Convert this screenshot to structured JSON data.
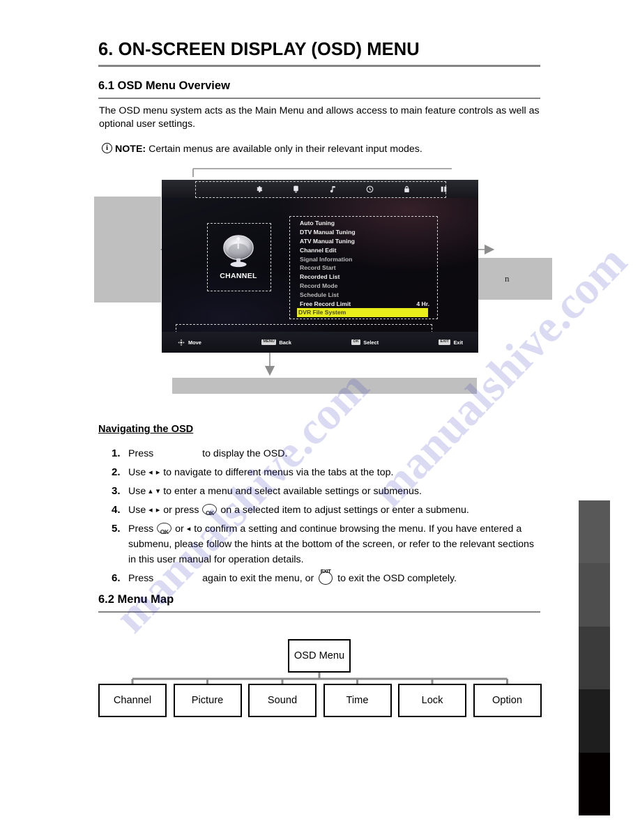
{
  "document": {
    "chapter_title": "6. ON-SCREEN DISPLAY (OSD) MENU",
    "section_1_title": "6.1 OSD Menu Overview",
    "overview_paragraph": "The OSD menu system acts as the Main Menu and allows access to main feature controls as well as optional user settings.",
    "note_label": "NOTE:",
    "note_text": "Certain menus are available only in their relevant input modes.",
    "note_icon": "info-circle-icon",
    "section_2_title": "6.2 Menu Map"
  },
  "figure": {
    "callout_left_text": "",
    "callout_right_text": "n",
    "callout_bottom_text": "",
    "tv_screen": {
      "tabs": [
        {
          "name": "channel",
          "icon": "gear-icon"
        },
        {
          "name": "picture",
          "icon": "monitor-icon"
        },
        {
          "name": "sound",
          "icon": "music-note-icon"
        },
        {
          "name": "time",
          "icon": "clock-icon"
        },
        {
          "name": "lock",
          "icon": "lock-icon"
        },
        {
          "name": "option",
          "icon": "grid-icon"
        }
      ],
      "panel_icon": "satellite-dish-icon",
      "panel_label": "CHANNEL",
      "menu_items": [
        {
          "label": "Auto Tuning",
          "value": "",
          "state": "normal"
        },
        {
          "label": "DTV Manual Tuning",
          "value": "",
          "state": "normal"
        },
        {
          "label": "ATV Manual Tuning",
          "value": "",
          "state": "normal"
        },
        {
          "label": "Channel Edit",
          "value": "",
          "state": "normal"
        },
        {
          "label": "Signal Information",
          "value": "",
          "state": "dim"
        },
        {
          "label": "Record Start",
          "value": "",
          "state": "dim"
        },
        {
          "label": "Recorded List",
          "value": "",
          "state": "normal"
        },
        {
          "label": "Record Mode",
          "value": "",
          "state": "dim"
        },
        {
          "label": "Schedule List",
          "value": "",
          "state": "dim"
        },
        {
          "label": "Free Record Limit",
          "value": "4 Hr.",
          "state": "normal"
        },
        {
          "label": "DVR File System",
          "value": "",
          "state": "selected"
        }
      ],
      "hints": [
        {
          "key": "",
          "key_icon": "dpad-icon",
          "label": "Move"
        },
        {
          "key": "MENU",
          "key_icon": "",
          "label": "Back"
        },
        {
          "key": "OK",
          "key_icon": "",
          "label": "Select"
        },
        {
          "key": "EXIT",
          "key_icon": "",
          "label": "Exit"
        }
      ]
    }
  },
  "navigation": {
    "heading": "Navigating the OSD",
    "steps": [
      {
        "num": "1.",
        "parts": [
          {
            "type": "text",
            "value": "Press "
          },
          {
            "type": "blank-key"
          },
          {
            "type": "text",
            "value": " to display the OSD."
          }
        ]
      },
      {
        "num": "2.",
        "parts": [
          {
            "type": "text",
            "value": "Use "
          },
          {
            "type": "arrows",
            "value": "◂ ▸"
          },
          {
            "type": "text",
            "value": " to navigate to different menus via the tabs at the top."
          }
        ]
      },
      {
        "num": "3.",
        "parts": [
          {
            "type": "text",
            "value": "Use "
          },
          {
            "type": "arrows",
            "value": "▴ ▾"
          },
          {
            "type": "text",
            "value": " to enter a menu and select available settings or submenus."
          }
        ]
      },
      {
        "num": "4.",
        "parts": [
          {
            "type": "text",
            "value": "Use "
          },
          {
            "type": "arrows",
            "value": "◂ ▸"
          },
          {
            "type": "text",
            "value": " or press "
          },
          {
            "type": "ok-key"
          },
          {
            "type": "text",
            "value": " on a selected item to adjust settings or enter a submenu."
          }
        ]
      },
      {
        "num": "5.",
        "parts": [
          {
            "type": "text",
            "value": "Press "
          },
          {
            "type": "ok-key"
          },
          {
            "type": "text",
            "value": " or "
          },
          {
            "type": "arrows",
            "value": "◂"
          },
          {
            "type": "text",
            "value": " to confirm a setting and continue browsing the menu. If you have entered a submenu, please follow the hints at the bottom of the screen, or refer to the relevant sections in this user manual for operation details."
          }
        ]
      },
      {
        "num": "6.",
        "parts": [
          {
            "type": "text",
            "value": "Press "
          },
          {
            "type": "blank-key"
          },
          {
            "type": "text",
            "value": " again to exit the menu, or "
          },
          {
            "type": "exit-key",
            "value": "EXIT"
          },
          {
            "type": "text",
            "value": " to exit the OSD completely."
          }
        ]
      }
    ]
  },
  "menu_map": {
    "root": "OSD Menu",
    "children": [
      "Channel",
      "Picture",
      "Sound",
      "Time",
      "Lock",
      "Option"
    ]
  },
  "edge_strip": {
    "segments": [
      "#585858",
      "#4e4e4e",
      "#3b3b3b",
      "#1e1e1e",
      "#050000"
    ]
  },
  "colors": {
    "rule": "#848484",
    "callout_gray": "#bfbfbf",
    "highlight_yellow": "#e9ee1a",
    "watermark": "#2b2bbb"
  },
  "watermark": {
    "line_1": "manualshive.com",
    "line_2": "manualshive.com"
  }
}
